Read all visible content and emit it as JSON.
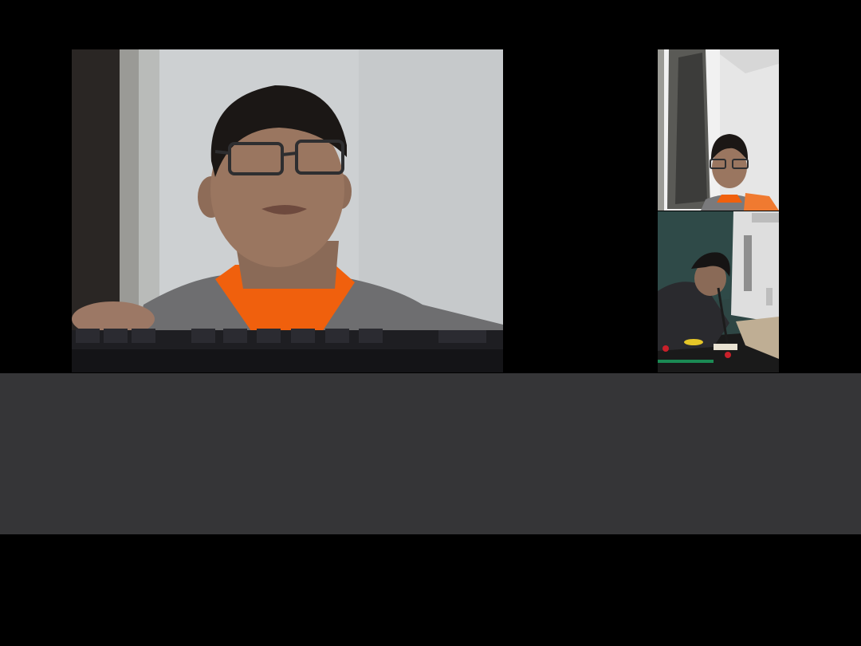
{
  "call": {
    "main_video": {
      "icon": "camera-feed",
      "participant": ""
    },
    "thumbnails": [
      {
        "icon": "camera-feed",
        "participant": ""
      },
      {
        "icon": "camera-feed",
        "participant": ""
      }
    ]
  },
  "colors": {
    "background": "#000000",
    "panel": "#353537",
    "accent_shirt": "#ff6a10"
  }
}
